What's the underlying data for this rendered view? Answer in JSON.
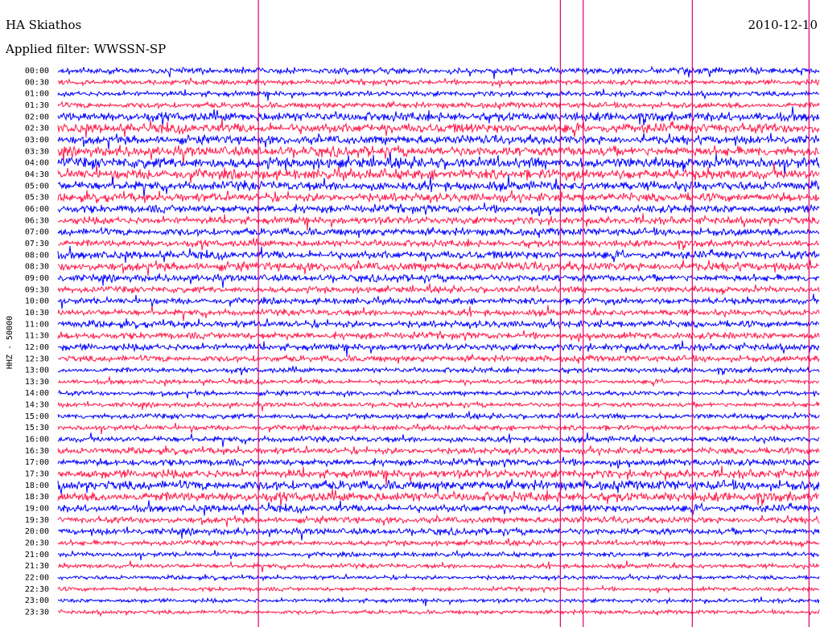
{
  "header": {
    "station": "HA Skiathos",
    "date": "2010-12-10",
    "filter_label": "Applied filter: WWSSN-SP"
  },
  "colors": {
    "background": "#ffffff",
    "trace_a": "#0000ff",
    "trace_b": "#ff1a4a",
    "event_marker": "#e0006a",
    "text": "#000000"
  },
  "chart_data": {
    "type": "line",
    "title": "HA Skiathos",
    "subtitle": "Applied filter: WWSSN-SP",
    "date": "2010-12-10",
    "ylabel": "HHZ - 50000",
    "xlabel": "",
    "grid": false,
    "legend": "none",
    "row_labels": [
      "00:00",
      "00:30",
      "01:00",
      "01:30",
      "02:00",
      "02:30",
      "03:00",
      "03:30",
      "04:00",
      "04:30",
      "05:00",
      "05:30",
      "06:00",
      "06:30",
      "07:00",
      "07:30",
      "08:00",
      "08:30",
      "09:00",
      "09:30",
      "10:00",
      "10:30",
      "11:00",
      "11:30",
      "12:00",
      "12:30",
      "13:00",
      "13:30",
      "14:00",
      "14:30",
      "15:00",
      "15:30",
      "16:00",
      "16:30",
      "17:00",
      "17:30",
      "18:00",
      "18:30",
      "19:00",
      "19:30",
      "20:00",
      "20:30",
      "21:00",
      "21:30",
      "22:00",
      "22:30",
      "23:00",
      "23:30"
    ],
    "row_colors": [
      "trace_a",
      "trace_b"
    ],
    "row_amplitude": [
      0.55,
      0.45,
      0.45,
      0.5,
      0.8,
      0.85,
      0.75,
      0.85,
      0.95,
      0.9,
      0.8,
      0.75,
      0.7,
      0.65,
      0.65,
      0.6,
      0.7,
      0.75,
      0.6,
      0.55,
      0.55,
      0.55,
      0.6,
      0.6,
      0.6,
      0.55,
      0.45,
      0.4,
      0.4,
      0.4,
      0.45,
      0.45,
      0.5,
      0.55,
      0.6,
      0.75,
      0.85,
      0.85,
      0.65,
      0.55,
      0.55,
      0.45,
      0.4,
      0.4,
      0.35,
      0.35,
      0.35,
      0.35
    ],
    "event_markers_minutes": [
      7.9,
      19.8,
      20.7,
      25.0,
      29.6
    ]
  }
}
